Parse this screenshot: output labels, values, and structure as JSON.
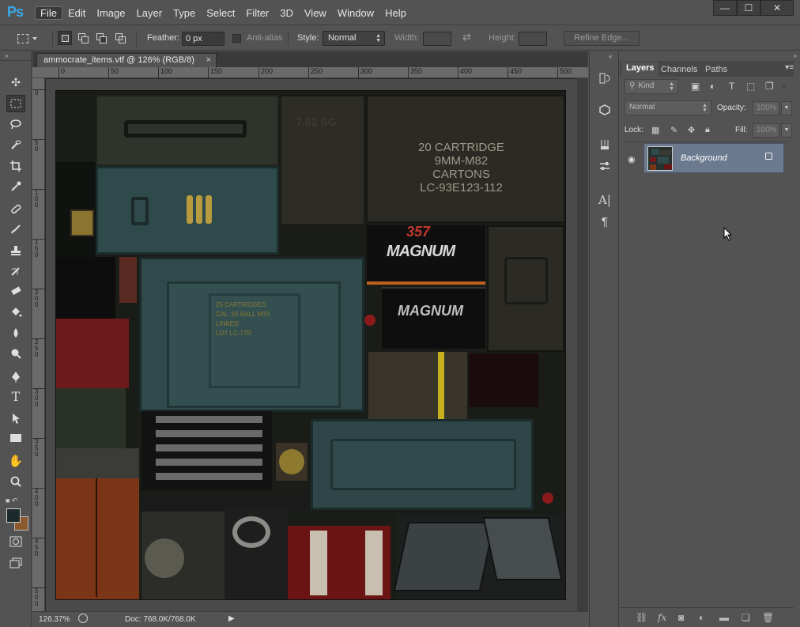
{
  "app": {
    "logo": "Ps"
  },
  "menu": [
    "File",
    "Edit",
    "Image",
    "Layer",
    "Type",
    "Select",
    "Filter",
    "3D",
    "View",
    "Window",
    "Help"
  ],
  "window_controls": {
    "minimize": "—",
    "maximize": "☐",
    "close": "✕"
  },
  "options": {
    "feather_label": "Feather:",
    "feather_value": "0 px",
    "antialias_label": "Anti-alias",
    "style_label": "Style:",
    "style_value": "Normal",
    "width_label": "Width:",
    "height_label": "Height:",
    "refine_edge_label": "Refine Edge..."
  },
  "document": {
    "tab_title": "ammocrate_items.vtf @ 126% (RGB/8)",
    "tab_close": "×",
    "ruler_h": [
      "0",
      "50",
      "100",
      "150",
      "200",
      "250",
      "300",
      "350",
      "400",
      "450",
      "500"
    ],
    "ruler_v": [
      "0",
      "5\n0",
      "1\n0\n0",
      "1\n5\n0",
      "2\n0\n0",
      "2\n5\n0",
      "3\n0\n0",
      "3\n5\n0",
      "4\n0\n0",
      "4\n5\n0",
      "5\n0\n0"
    ],
    "texture_text": {
      "cartridge_lines": [
        "20 CARTRIDGE",
        "9MM-M82",
        "CARTONS",
        "LC-93E123-112"
      ],
      "crate_lines": [
        "25 CARTRIDGES",
        "CAL .50 BALL M33",
        "LINKED",
        "LOT LC-77R"
      ],
      "magnum_top": "357",
      "magnum": "MAGNUM",
      "magnum2": "MAGNUM",
      "stencil": "7.62 SG"
    }
  },
  "status": {
    "zoom": "126.37%",
    "doc": "Doc: 768.0K/768.0K"
  },
  "layers_panel": {
    "tabs": [
      "Layers",
      "Channels",
      "Paths"
    ],
    "active_tab": "Layers",
    "filter_value": "Kind",
    "blend_mode": "Normal",
    "opacity_label": "Opacity:",
    "opacity_value": "100%",
    "lock_label": "Lock:",
    "fill_label": "Fill:",
    "fill_value": "100%",
    "layers": [
      {
        "name": "Background",
        "visible": true,
        "locked": true
      }
    ]
  },
  "colors": {
    "app_bg": "#535353",
    "pasteboard": "#4a4a4a",
    "selected_layer": "#6c7a8f",
    "ps_blue": "#38a8e6",
    "foreground_swatch": "#1c2a2c",
    "background_swatch": "#8a5a2e"
  }
}
